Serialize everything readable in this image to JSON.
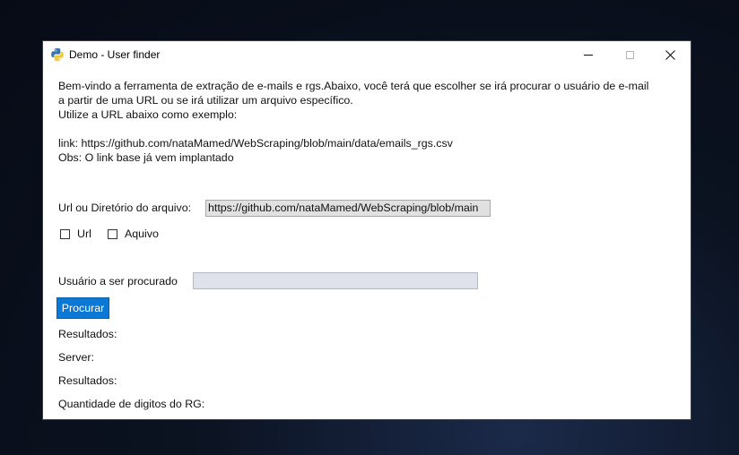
{
  "window": {
    "title": "Demo - User finder",
    "icon": "python-icon"
  },
  "intro": {
    "line1": "Bem-vindo a ferramenta de extração de e-mails e rgs.Abaixo, você terá que escolher se irá procurar o usuário de e-mail",
    "line2": "a partir de uma URL ou se irá utilizar um arquivo específico.",
    "line3": "Utilize a URL abaixo como exemplo:",
    "line4": "link: https://github.com/nataMamed/WebScraping/blob/main/data/emails_rgs.csv",
    "line5": "Obs: O link base já vem implantado"
  },
  "source": {
    "label": "Url ou Diretório do arquivo:",
    "value": "https://github.com/nataMamed/WebScraping/blob/main",
    "options": [
      {
        "label": "Url",
        "checked": false
      },
      {
        "label": "Aquivo",
        "checked": false
      }
    ]
  },
  "user": {
    "label": "Usuário a ser procurado",
    "value": ""
  },
  "search_button": "Procurar",
  "results": {
    "results_label_1": "Resultados:",
    "server_label": "Server:",
    "results_label_2": "Resultados:",
    "rg_digits_label": "Quantidade de digitos do RG:"
  },
  "colors": {
    "button_bg": "#0a78d4",
    "input_bg": "#e1e1e1",
    "user_input_bg": "#dfe2ea"
  }
}
